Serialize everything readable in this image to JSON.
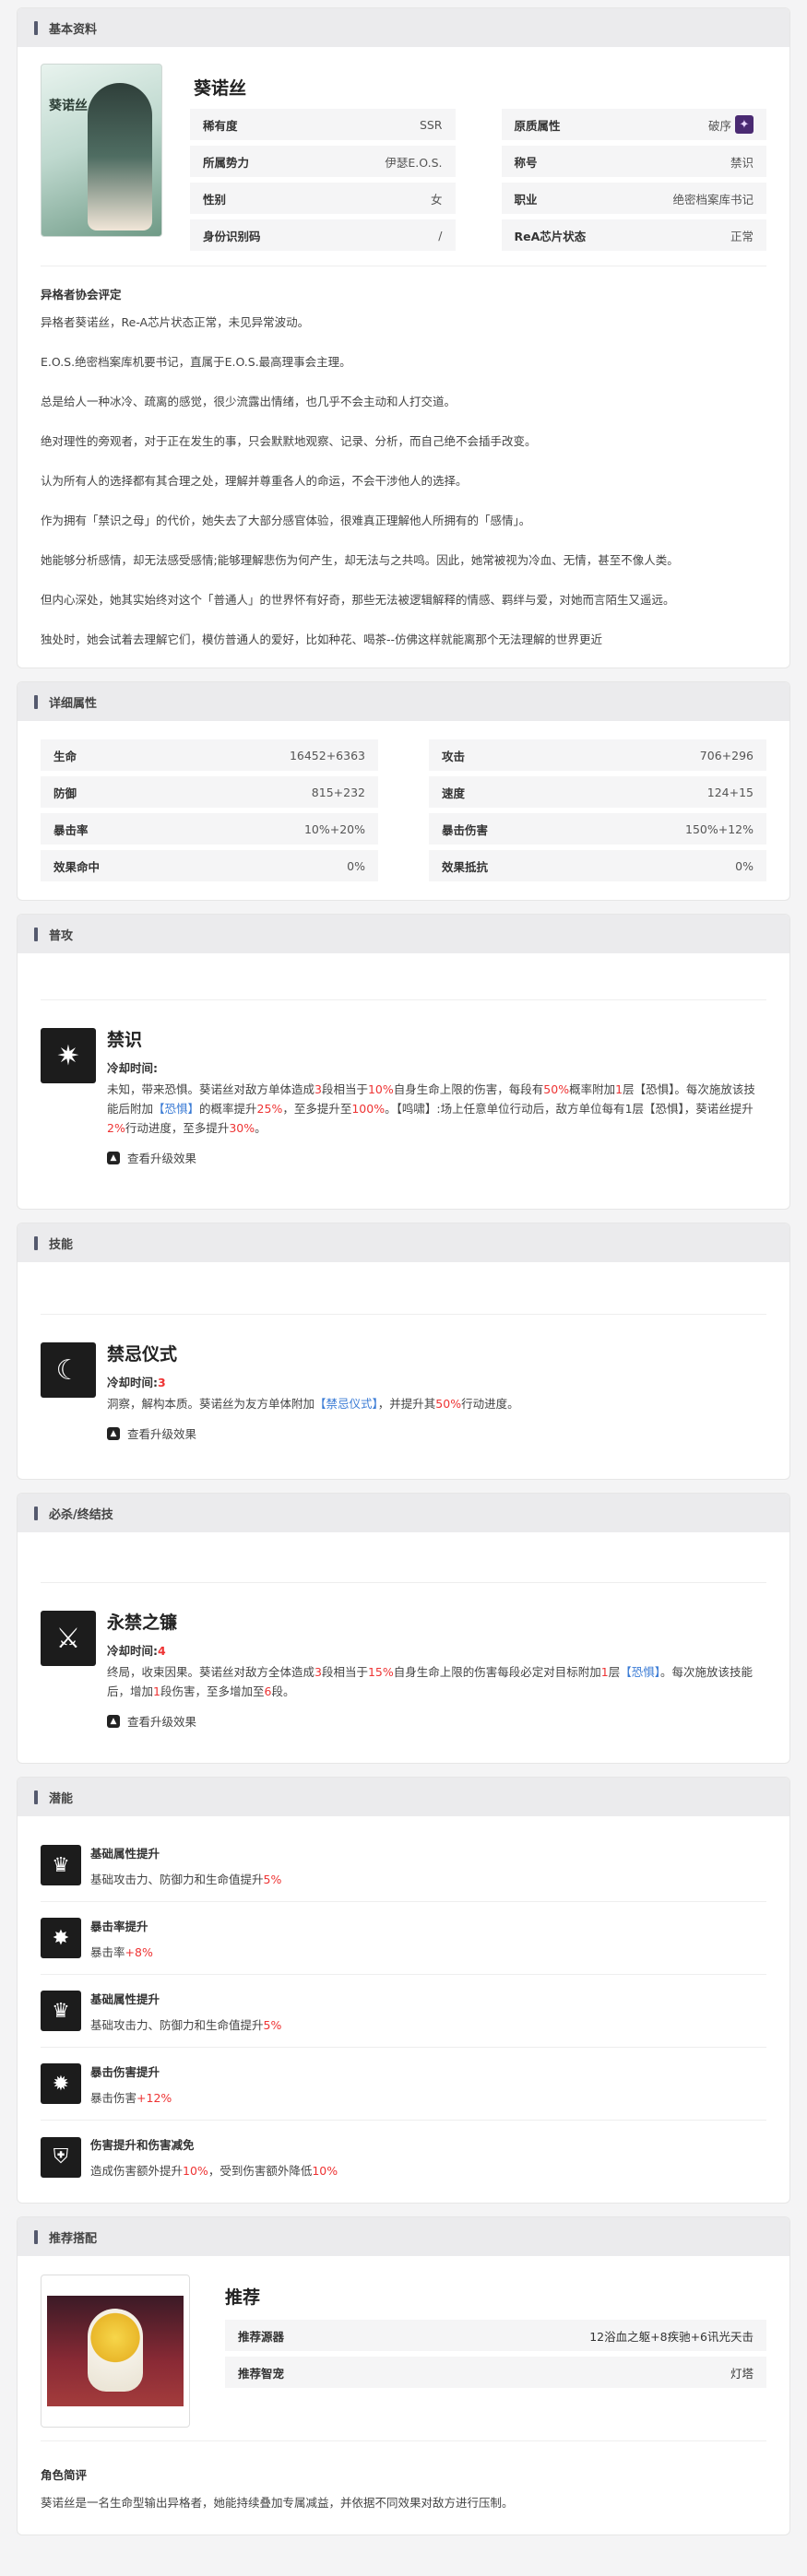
{
  "basic": {
    "header": "基本资料",
    "portrait_name": "葵诺丝",
    "name": "葵诺丝",
    "fields": [
      {
        "k": "稀有度",
        "v": "SSR"
      },
      {
        "k": "原质属性",
        "v": "破序"
      },
      {
        "k": "所属势力",
        "v": "伊瑟E.O.S."
      },
      {
        "k": "称号",
        "v": "禁识"
      },
      {
        "k": "性别",
        "v": "女"
      },
      {
        "k": "职业",
        "v": "绝密档案库书记"
      },
      {
        "k": "身份识别码",
        "v": "/"
      },
      {
        "k": "ReA芯片状态",
        "v": "正常"
      }
    ],
    "attr_icon": "crystal-icon",
    "eval_title": "异格者协会评定",
    "eval": [
      "异格者葵诺丝，Re-A芯片状态正常，未见异常波动。",
      "E.O.S.绝密档案库机要书记，直属于E.O.S.最高理事会主理。",
      "总是给人一种冰冷、疏离的感觉，很少流露出情绪，也几乎不会主动和人打交道。",
      "绝对理性的旁观者，对于正在发生的事，只会默默地观察、记录、分析，而自己绝不会插手改变。",
      "认为所有人的选择都有其合理之处，理解并尊重各人的命运，不会干涉他人的选择。",
      "作为拥有「禁识之母」的代价，她失去了大部分感官体验，很难真正理解他人所拥有的「感情」。",
      "她能够分析感情，却无法感受感情;能够理解悲伤为何产生，却无法与之共鸣。因此，她常被视为冷血、无情，甚至不像人类。",
      "但内心深处，她其实始终对这个「普通人」的世界怀有好奇，那些无法被逻辑解释的情感、羁绊与爱，对她而言陌生又遥远。",
      "独处时，她会试着去理解它们，模仿普通人的爱好，比如种花、喝茶--仿佛这样就能离那个无法理解的世界更近"
    ]
  },
  "detail": {
    "header": "详细属性",
    "fields": [
      {
        "k": "生命",
        "v": "16452+6363"
      },
      {
        "k": "攻击",
        "v": "706+296"
      },
      {
        "k": "防御",
        "v": "815+232"
      },
      {
        "k": "速度",
        "v": "124+15"
      },
      {
        "k": "暴击率",
        "v": "10%+20%"
      },
      {
        "k": "暴击伤害",
        "v": "150%+12%"
      },
      {
        "k": "效果命中",
        "v": "0%"
      },
      {
        "k": "效果抵抗",
        "v": "0%"
      }
    ]
  },
  "normal": {
    "header": "普攻",
    "name": "禁识",
    "cd_label": "冷却时间:",
    "cd": "",
    "icon": "forbidden-knowledge-icon",
    "desc": [
      {
        "t": "未知，带来恐惧。葵诺丝对敌方单体造成"
      },
      {
        "t": "3",
        "c": "red"
      },
      {
        "t": "段相当于"
      },
      {
        "t": "10%",
        "c": "red"
      },
      {
        "t": "自身生命上限的伤害，每段有"
      },
      {
        "t": "50%",
        "c": "red"
      },
      {
        "t": "概率附加"
      },
      {
        "t": "1",
        "c": "red"
      },
      {
        "t": "层【恐惧】。每次施放该技能后附加"
      },
      {
        "t": "【恐惧】",
        "c": "blue"
      },
      {
        "t": "的概率提升"
      },
      {
        "t": "25%",
        "c": "red"
      },
      {
        "t": "，至多提升至"
      },
      {
        "t": "100%",
        "c": "red"
      },
      {
        "t": "。【鸣啸】:场上任意单位行动后，敌方单位每有1层【恐惧】，葵诺丝提升"
      },
      {
        "t": "2%",
        "c": "red"
      },
      {
        "t": "行动进度，至多提升"
      },
      {
        "t": "30%",
        "c": "red"
      },
      {
        "t": "。"
      }
    ],
    "upgrade": "查看升级效果"
  },
  "skill": {
    "header": "技能",
    "name": "禁忌仪式",
    "cd_label": "冷却时间:",
    "cd": "3",
    "icon": "ritual-icon",
    "desc": [
      {
        "t": "洞察，解构本质。葵诺丝为友方单体附加"
      },
      {
        "t": "【禁忌仪式】",
        "c": "blue"
      },
      {
        "t": "，并提升其"
      },
      {
        "t": "50%",
        "c": "red"
      },
      {
        "t": "行动进度。"
      }
    ],
    "upgrade": "查看升级效果"
  },
  "ultimate": {
    "header": "必杀/终结技",
    "name": "永禁之镰",
    "cd_label": "冷却时间:",
    "cd": "4",
    "icon": "scythe-icon",
    "desc": [
      {
        "t": "终局，收束因果。葵诺丝对敌方全体造成"
      },
      {
        "t": "3",
        "c": "red"
      },
      {
        "t": "段相当于"
      },
      {
        "t": "15%",
        "c": "red"
      },
      {
        "t": "自身生命上限的伤害每段必定对目标附加"
      },
      {
        "t": "1",
        "c": "red"
      },
      {
        "t": "层"
      },
      {
        "t": "【恐惧】",
        "c": "blue"
      },
      {
        "t": "。每次施放该技能后，增加"
      },
      {
        "t": "1",
        "c": "red"
      },
      {
        "t": "段伤害，至多增加至"
      },
      {
        "t": "6",
        "c": "red"
      },
      {
        "t": "段。"
      }
    ],
    "upgrade": "查看升级效果"
  },
  "potential": {
    "header": "潜能",
    "items": [
      {
        "name": "基础属性提升",
        "desc": "基础攻击力、防御力和生命值提升",
        "val": "5%",
        "icon": "crown-icon"
      },
      {
        "name": "暴击率提升",
        "desc": "暴击率",
        "val": "+8%",
        "icon": "star-burst-icon"
      },
      {
        "name": "基础属性提升",
        "desc": "基础攻击力、防御力和生命值提升",
        "val": "5%",
        "icon": "crown-icon"
      },
      {
        "name": "暴击伤害提升",
        "desc": "暴击伤害",
        "val": "+12%",
        "icon": "gear-burst-icon"
      },
      {
        "name": "伤害提升和伤害减免",
        "desc_a": "造成伤害额外提升",
        "val_a": "10%",
        "desc_b": "，受到伤害额外降低",
        "val_b": "10%",
        "icon": "shield-icon"
      }
    ]
  },
  "recommend": {
    "header": "推荐搭配",
    "title": "推荐",
    "rows": [
      {
        "k": "推荐源器",
        "v": "12浴血之躯+8疾驰+6讯光天击"
      },
      {
        "k": "推荐智宠",
        "v": "灯塔"
      }
    ],
    "review_title": "角色简评",
    "review": "葵诺丝是一名生命型输出异格者，她能持续叠加专属减益，并依据不同效果对敌方进行压制。"
  }
}
